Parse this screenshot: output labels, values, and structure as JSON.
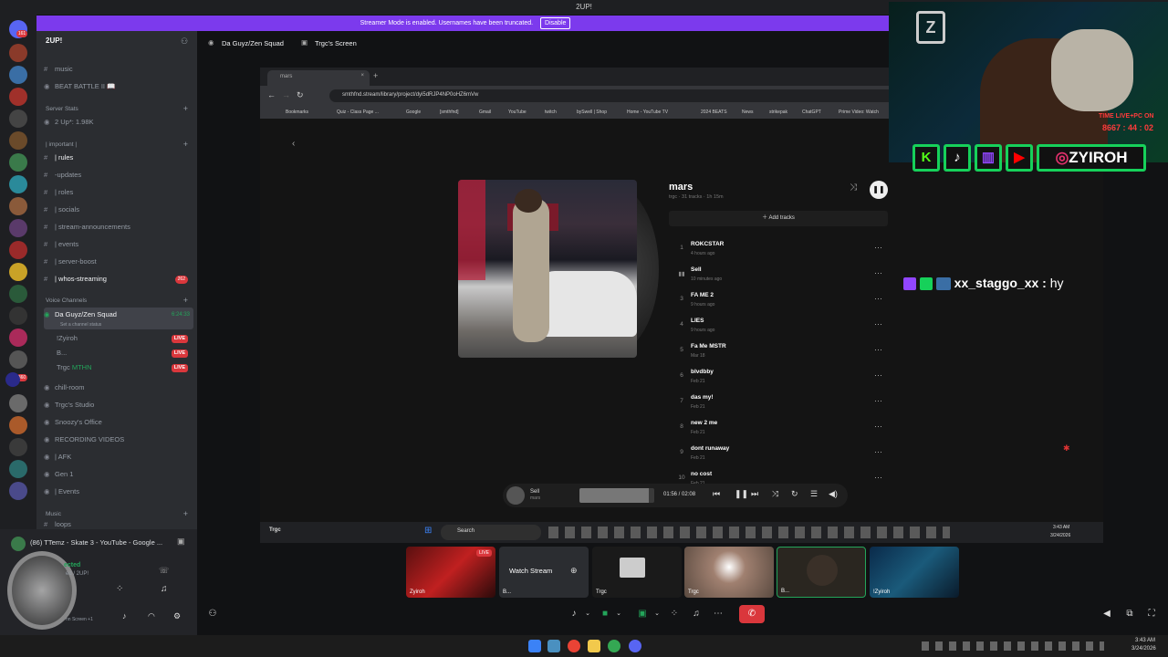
{
  "window": {
    "title": "2UP!"
  },
  "banner": {
    "text": "Streamer Mode is enabled. Usernames have been truncated.",
    "disable": "Disable"
  },
  "server": {
    "name": "2UP!"
  },
  "rail_badges": [
    "161",
    "360"
  ],
  "channels": {
    "top": [
      {
        "label": "music"
      },
      {
        "label": "BEAT BATTLE II 📖"
      }
    ],
    "cat_stats": "Server Stats",
    "stat_item": "2 Up*: 1.98K",
    "cat_important": "| important |",
    "important": [
      {
        "label": "| rules",
        "active": true
      },
      {
        "label": "-updates"
      },
      {
        "label": "| roles"
      },
      {
        "label": "| socials"
      },
      {
        "label": "| stream-announcements"
      },
      {
        "label": "| events"
      },
      {
        "label": "| server-boost"
      },
      {
        "label": "| whos-streaming",
        "badge": "262"
      }
    ],
    "cat_voice": "Voice Channels",
    "voice_active": {
      "label": "Da Guyz/Zen Squad",
      "time": "6:24:33",
      "status": "Set a channel status"
    },
    "voice_users": [
      {
        "name": "!Zyiroh",
        "live": "LIVE"
      },
      {
        "name": "B...",
        "live": "LIVE"
      },
      {
        "name": "Trgc",
        "extra": "MTHN",
        "live": "LIVE"
      }
    ],
    "voice_more": [
      {
        "label": "chill-room"
      },
      {
        "label": "Trgc's Studio"
      },
      {
        "label": "Snoozy's Office"
      },
      {
        "label": "RECORDING VIDEOS"
      },
      {
        "label": "| AFK"
      },
      {
        "label": "Gen 1"
      },
      {
        "label": "| Events"
      }
    ],
    "cat_music": "Music",
    "music_item": "loops"
  },
  "user_panel": {
    "activity": "(86) TTemz - Skate 3 - YouTube - Google ...",
    "connected": "ected",
    "sub": "ed / 2UP!",
    "screen": "nn Screen +1"
  },
  "main_header": {
    "channel": "Da Guyz/Zen Squad",
    "screen": "Trgc's Screen"
  },
  "browser": {
    "tab": "mars",
    "url": "smthfnd.stream/library/project/dyi5dRJP4NP0oHZ6mVw",
    "bookmarks": [
      "Bookmarks",
      "Quiz - Class Page ...",
      "Google",
      "[smthfnd]",
      "Gmail",
      "YouTube",
      "twitch",
      "bySwell | Shop",
      "Home - YouTube TV",
      "2024 BEATS",
      "News",
      "strikepak",
      "ChatGPT",
      "Prime Video: Watch"
    ]
  },
  "album": {
    "title": "mars",
    "meta": "trgc · 31 tracks · 1h 15m",
    "add": "Add tracks"
  },
  "tracks": [
    {
      "num": "1",
      "title": "ROKCSTAR",
      "sub": "4 hours ago"
    },
    {
      "num": "",
      "title": "Sell",
      "sub": "10 minutes ago"
    },
    {
      "num": "3",
      "title": "FA ME 2",
      "sub": "9 hours ago"
    },
    {
      "num": "4",
      "title": "LIES",
      "sub": "9 hours ago"
    },
    {
      "num": "5",
      "title": "Fa Me MSTR",
      "sub": "Mar 18"
    },
    {
      "num": "6",
      "title": "blvdbby",
      "sub": "Feb 21"
    },
    {
      "num": "7",
      "title": "das my!",
      "sub": "Feb 21"
    },
    {
      "num": "8",
      "title": "new 2 me",
      "sub": "Feb 21"
    },
    {
      "num": "9",
      "title": "dont runaway",
      "sub": "Feb 21"
    },
    {
      "num": "10",
      "title": "no cost",
      "sub": "Feb 21"
    }
  ],
  "player": {
    "title": "Sell",
    "artist": "mars",
    "time": "01:56 / 02:08",
    "progress": 0.93
  },
  "inner_taskbar": {
    "label": "Trgc",
    "search": "Search",
    "clock": "3:43 AM",
    "date": "3/24/2026"
  },
  "overlay": {
    "handle": "ZYIROH",
    "cam_text_1": "TIME LIVE+PC ON",
    "cam_text_2": "8667 : 44 : 02"
  },
  "chat": {
    "user": "xx_staggo_xx",
    "sep": ":",
    "message": "hy"
  },
  "thumbnails": [
    {
      "label": "Zyiroh",
      "badge": "LIVE"
    },
    {
      "label": "B...",
      "text": "Watch Stream"
    },
    {
      "label": "Trgc"
    },
    {
      "label": "Trgc"
    },
    {
      "label": "B..."
    },
    {
      "label": "!Zyiroh"
    }
  ],
  "taskbar": {
    "time": "3:43 AM",
    "date": "3/24/2026"
  },
  "colors": {
    "accent": "#7c3aed",
    "live": "#da373c",
    "overlay_green": "#16d15a",
    "discord_bg": "#2b2d31"
  }
}
